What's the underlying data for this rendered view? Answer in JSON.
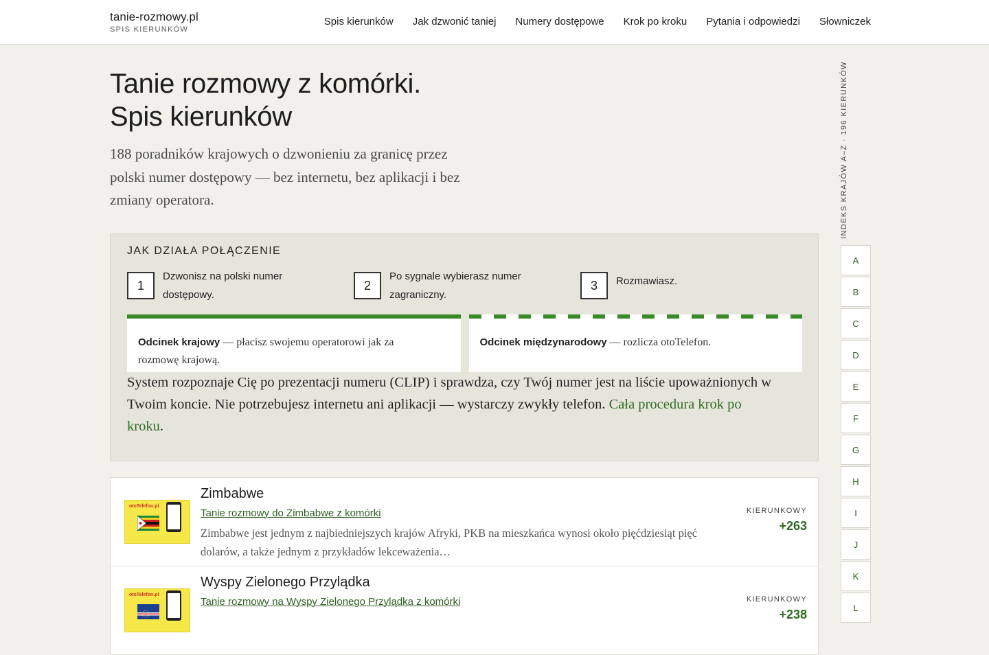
{
  "header": {
    "brand_name": "tanie-rozmowy.pl",
    "brand_sub": "SPIS KIERUNKÓW",
    "nav": [
      {
        "label": "Spis kierunków"
      },
      {
        "label": "Jak dzwonić taniej"
      },
      {
        "label": "Numery dostępowe"
      },
      {
        "label": "Krok po kroku"
      },
      {
        "label": "Pytania i odpowiedzi"
      },
      {
        "label": "Słowniczek"
      }
    ]
  },
  "hero": {
    "title_line1": "Tanie rozmowy z komórki.",
    "title_line2": "Spis kierunków",
    "lead": "188 poradników krajowych o dzwonieniu za granicę przez polski numer dostępowy — bez internetu, bez aplikacji i bez zmiany operatora."
  },
  "info": {
    "heading": "JAK DZIAŁA POŁĄCZENIE",
    "steps": [
      {
        "num": "1",
        "text": "Dzwonisz na polski numer dostępowy."
      },
      {
        "num": "2",
        "text": "Po sygnale wybierasz numer zagraniczny."
      },
      {
        "num": "3",
        "text": "Rozmawiasz."
      }
    ],
    "segment_domestic_title": "Odcinek krajowy",
    "segment_domestic_text": " — płacisz swojemu operatorowi jak za rozmowę krajową.",
    "segment_intl_title": "Odcinek międzynarodowy",
    "segment_intl_text": " — rozlicza otoTelefon.",
    "paragraph": "System rozpoznaje Cię po prezentacji numeru (CLIP) i sprawdza, czy Twój numer jest na liście upoważnionych w Twoim koncie. Nie potrzebujesz internetu ani aplikacji — wystarczy zwykły telefon. ",
    "paragraph_link": "Cała procedura krok po kroku",
    "paragraph_end": ".",
    "accent_color": "#3a8a2a"
  },
  "countries": [
    {
      "name": "Zimbabwe",
      "link": "Tanie rozmowy do Zimbabwe z komórki",
      "desc": "Zimbabwe jest jednym z najbiedniejszych krajów Afryki, PKB na mieszkańca wynosi około pięćdziesiąt pięć dolarów, a także jednym z przykładów lekceważenia…",
      "dial_label": "KIERUNKOWY",
      "dial_code": "+263",
      "thumb_logo": "otoTelefon.pl"
    },
    {
      "name": "Wyspy Zielonego Przylądka",
      "link": "Tanie rozmowy na Wyspy Zielonego Przylądka z komórki",
      "desc": "",
      "dial_label": "KIERUNKOWY",
      "dial_code": "+238",
      "thumb_logo": "otoTelefon.pl"
    }
  ],
  "index": {
    "label": "INDEKS KRAJÓW A–Z · 196 KIERUNKÓW",
    "letters": [
      "A",
      "B",
      "C",
      "D",
      "E",
      "F",
      "G",
      "H",
      "I",
      "J",
      "K",
      "L"
    ]
  }
}
